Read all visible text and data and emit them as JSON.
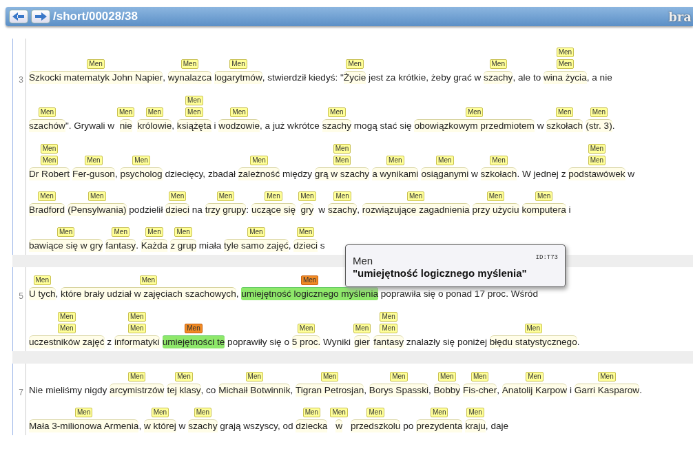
{
  "header": {
    "path": "/short/00028/38",
    "logo": "bra"
  },
  "sentences": [
    {
      "number": "3",
      "lines": [
        {
          "segments": [
            {
              "kind": "span",
              "text": "Szkocki matematyk John Napier",
              "labels": [
                "Men"
              ],
              "highlighted": false
            },
            {
              "kind": "plain",
              "text": ", "
            },
            {
              "kind": "span",
              "text": "wynalazca",
              "labels": [
                "Men"
              ],
              "highlighted": false
            },
            {
              "kind": "span",
              "text": "logarytmów",
              "labels": [
                "Men"
              ],
              "highlighted": false
            },
            {
              "kind": "plain",
              "text": ", stwierdził kiedyś: \""
            },
            {
              "kind": "span",
              "text": "Życie",
              "labels": [
                "Men"
              ],
              "highlighted": false
            },
            {
              "kind": "plain",
              "text": " jest za krótkie, żeby grać w "
            },
            {
              "kind": "span",
              "text": "szachy",
              "labels": [
                "Men"
              ],
              "highlighted": false
            },
            {
              "kind": "plain",
              "text": ", ale to "
            },
            {
              "kind": "span",
              "text": "wina życia",
              "labels": [
                "Men",
                "Men"
              ],
              "highlighted": false
            },
            {
              "kind": "plain",
              "text": ", a nie"
            }
          ]
        },
        {
          "segments": [
            {
              "kind": "span",
              "text": "szachów",
              "labels": [
                "Men"
              ],
              "highlighted": false
            },
            {
              "kind": "plain",
              "text": "\". Grywali w "
            },
            {
              "kind": "span",
              "text": "nie",
              "labels": [
                "Men"
              ],
              "highlighted": false
            },
            {
              "kind": "span",
              "text": "królowie",
              "labels": [
                "Men"
              ],
              "highlighted": false
            },
            {
              "kind": "plain",
              "text": ", "
            },
            {
              "kind": "span",
              "text": "książęta",
              "labels": [
                "Men",
                "Men"
              ],
              "highlighted": false
            },
            {
              "kind": "plain",
              "text": " i "
            },
            {
              "kind": "span",
              "text": "wodzowie",
              "labels": [
                "Men"
              ],
              "highlighted": false
            },
            {
              "kind": "plain",
              "text": ", a już wkrótce "
            },
            {
              "kind": "span",
              "text": "szachy",
              "labels": [
                "Men"
              ],
              "highlighted": false
            },
            {
              "kind": "plain",
              "text": " mogą stać się "
            },
            {
              "kind": "span",
              "text": "obowiązkowym przedmiotem",
              "labels": [
                "Men"
              ],
              "highlighted": false
            },
            {
              "kind": "plain",
              "text": " w "
            },
            {
              "kind": "span",
              "text": "szkołach",
              "labels": [
                "Men"
              ],
              "highlighted": false
            },
            {
              "kind": "span",
              "text": "(str. 3)",
              "labels": [
                "Men"
              ],
              "highlighted": false
            },
            {
              "kind": "plain",
              "text": "."
            }
          ]
        },
        {
          "segments": [
            {
              "kind": "span",
              "text": "Dr Robert",
              "labels": [
                "Men",
                "Men"
              ],
              "highlighted": false
            },
            {
              "kind": "span",
              "text": "Fer-guson",
              "labels": [
                "Men"
              ],
              "highlighted": false
            },
            {
              "kind": "plain",
              "text": ", "
            },
            {
              "kind": "span",
              "text": "psycholog",
              "labels": [
                "Men"
              ],
              "highlighted": false
            },
            {
              "kind": "plain",
              "text": " dziecięcy, zbadał "
            },
            {
              "kind": "span",
              "text": "zależność",
              "labels": [
                "Men"
              ],
              "highlighted": false
            },
            {
              "kind": "plain",
              "text": " między "
            },
            {
              "kind": "span",
              "text": "grą w szachy",
              "labels": [
                "Men",
                "Men"
              ],
              "highlighted": false
            },
            {
              "kind": "span",
              "text": "a wynikami",
              "labels": [
                "Men"
              ],
              "highlighted": false
            },
            {
              "kind": "span",
              "text": "osiąganymi",
              "labels": [
                "Men"
              ],
              "highlighted": false
            },
            {
              "kind": "plain",
              "text": " w "
            },
            {
              "kind": "span",
              "text": "szkołach",
              "labels": [
                "Men"
              ],
              "highlighted": false
            },
            {
              "kind": "plain",
              "text": ". W jednej z "
            },
            {
              "kind": "span",
              "text": "podstawówek",
              "labels": [
                "Men",
                "Men"
              ],
              "highlighted": false
            },
            {
              "kind": "plain",
              "text": " w"
            }
          ]
        },
        {
          "segments": [
            {
              "kind": "span",
              "text": "Bradford",
              "labels": [
                "Men"
              ],
              "highlighted": false
            },
            {
              "kind": "span",
              "text": "(Pensylwania)",
              "labels": [
                "Men"
              ],
              "highlighted": false
            },
            {
              "kind": "plain",
              "text": " podzielił "
            },
            {
              "kind": "span",
              "text": "dzieci",
              "labels": [
                "Men"
              ],
              "highlighted": false
            },
            {
              "kind": "plain",
              "text": " na "
            },
            {
              "kind": "span",
              "text": "trzy grupy",
              "labels": [
                "Men"
              ],
              "highlighted": false
            },
            {
              "kind": "plain",
              "text": ": "
            },
            {
              "kind": "span",
              "text": "uczące się",
              "labels": [
                "Men"
              ],
              "highlighted": false
            },
            {
              "kind": "span",
              "text": "gry",
              "labels": [
                "Men"
              ],
              "highlighted": false
            },
            {
              "kind": "plain",
              "text": " w "
            },
            {
              "kind": "span",
              "text": "szachy",
              "labels": [
                "Men"
              ],
              "highlighted": false
            },
            {
              "kind": "plain",
              "text": ", "
            },
            {
              "kind": "span",
              "text": "rozwiązujące zagadnienia",
              "labels": [
                "Men"
              ],
              "highlighted": false
            },
            {
              "kind": "span",
              "text": "przy użyciu",
              "labels": [
                "Men"
              ],
              "highlighted": false
            },
            {
              "kind": "span",
              "text": "komputera",
              "labels": [
                "Men"
              ],
              "highlighted": false
            },
            {
              "kind": "plain",
              "text": " i"
            }
          ]
        },
        {
          "segments": [
            {
              "kind": "span",
              "text": "bawiące się w gry",
              "labels": [
                "Men"
              ],
              "highlighted": false
            },
            {
              "kind": "span",
              "text": "fantasy",
              "labels": [
                "Men"
              ],
              "highlighted": false
            },
            {
              "kind": "plain",
              "text": ". "
            },
            {
              "kind": "span",
              "text": "Każda",
              "labels": [
                "Men"
              ],
              "highlighted": false
            },
            {
              "kind": "span",
              "text": "z grup",
              "labels": [
                "Men"
              ],
              "highlighted": false
            },
            {
              "kind": "plain",
              "text": " miała "
            },
            {
              "kind": "span",
              "text": "tyle samo zajęć",
              "labels": [
                "Men"
              ],
              "highlighted": false
            },
            {
              "kind": "plain",
              "text": ", "
            },
            {
              "kind": "span",
              "text": "dzieci",
              "labels": [
                "Men"
              ],
              "highlighted": false
            },
            {
              "kind": "plain",
              "text": " s"
            }
          ]
        }
      ]
    },
    {
      "number": "5",
      "lines": [
        {
          "segments": [
            {
              "kind": "span",
              "text": "U tych",
              "labels": [
                "Men"
              ],
              "highlighted": false
            },
            {
              "kind": "plain",
              "text": ", "
            },
            {
              "kind": "span",
              "text": "które brały udział w zajęciach szachowych",
              "labels": [
                "Men"
              ],
              "highlighted": false
            },
            {
              "kind": "plain",
              "text": ", "
            },
            {
              "kind": "span",
              "text": "umiejętność logicznego myślenia",
              "labels": [
                "Men"
              ],
              "highlighted": true
            },
            {
              "kind": "plain",
              "text": " poprawiła się o ponad 17 proc. Wśród"
            }
          ]
        },
        {
          "segments": [
            {
              "kind": "span",
              "text": "uczestników zajęć",
              "labels": [
                "Men",
                "Men"
              ],
              "highlighted": false
            },
            {
              "kind": "plain",
              "text": " z "
            },
            {
              "kind": "span",
              "text": "informatyki",
              "labels": [
                "Men",
                "Men"
              ],
              "highlighted": false
            },
            {
              "kind": "span",
              "text": "umiejętności te",
              "labels": [
                "Men"
              ],
              "highlighted": true
            },
            {
              "kind": "plain",
              "text": " poprawiły się o "
            },
            {
              "kind": "span",
              "text": "5 proc.",
              "labels": [
                "Men"
              ],
              "highlighted": false
            },
            {
              "kind": "plain",
              "text": " Wyniki "
            },
            {
              "kind": "span",
              "text": "gier",
              "labels": [
                "Men"
              ],
              "highlighted": false
            },
            {
              "kind": "span",
              "text": "fantasy",
              "labels": [
                "Men",
                "Men"
              ],
              "highlighted": false
            },
            {
              "kind": "plain",
              "text": " znalazły się poniżej "
            },
            {
              "kind": "span",
              "text": "błędu statystycznego",
              "labels": [
                "Men"
              ],
              "highlighted": false
            },
            {
              "kind": "plain",
              "text": "."
            }
          ]
        }
      ]
    },
    {
      "number": "7",
      "lines": [
        {
          "segments": [
            {
              "kind": "plain",
              "text": "Nie mieliśmy nigdy "
            },
            {
              "kind": "span",
              "text": "arcymistrzów",
              "labels": [
                "Men"
              ],
              "highlighted": false
            },
            {
              "kind": "span",
              "text": "tej klasy",
              "labels": [
                "Men"
              ],
              "highlighted": false
            },
            {
              "kind": "plain",
              "text": ", co "
            },
            {
              "kind": "span",
              "text": "Michaił Botwinnik",
              "labels": [
                "Men"
              ],
              "highlighted": false
            },
            {
              "kind": "plain",
              "text": ", "
            },
            {
              "kind": "span",
              "text": "Tigran Petrosjan",
              "labels": [
                "Men"
              ],
              "highlighted": false
            },
            {
              "kind": "plain",
              "text": ", "
            },
            {
              "kind": "span",
              "text": "Borys Spasski",
              "labels": [
                "Men"
              ],
              "highlighted": false
            },
            {
              "kind": "plain",
              "text": ", "
            },
            {
              "kind": "span",
              "text": "Bobby",
              "labels": [
                "Men"
              ],
              "highlighted": false
            },
            {
              "kind": "span",
              "text": "Fis-cher",
              "labels": [
                "Men"
              ],
              "highlighted": false
            },
            {
              "kind": "plain",
              "text": ", "
            },
            {
              "kind": "span",
              "text": "Anatolij Karpow",
              "labels": [
                "Men"
              ],
              "highlighted": false
            },
            {
              "kind": "plain",
              "text": " i "
            },
            {
              "kind": "span",
              "text": "Garri Kasparow",
              "labels": [
                "Men"
              ],
              "highlighted": false
            },
            {
              "kind": "plain",
              "text": "."
            }
          ]
        },
        {
          "segments": [
            {
              "kind": "span",
              "text": "Mała 3-milionowa Armenia",
              "labels": [
                "Men"
              ],
              "highlighted": false
            },
            {
              "kind": "plain",
              "text": ", "
            },
            {
              "kind": "span",
              "text": "w której",
              "labels": [
                "Men"
              ],
              "highlighted": false
            },
            {
              "kind": "plain",
              "text": " w "
            },
            {
              "kind": "span",
              "text": "szachy",
              "labels": [
                "Men"
              ],
              "highlighted": false
            },
            {
              "kind": "plain",
              "text": " grają wszyscy, od "
            },
            {
              "kind": "span",
              "text": "dziecka",
              "labels": [
                "Men"
              ],
              "highlighted": false
            },
            {
              "kind": "span",
              "text": "w",
              "labels": [
                "Men"
              ],
              "highlighted": false
            },
            {
              "kind": "span",
              "text": "przedszkolu",
              "labels": [
                "Men"
              ],
              "highlighted": false
            },
            {
              "kind": "plain",
              "text": " po "
            },
            {
              "kind": "span",
              "text": "prezydenta",
              "labels": [
                "Men"
              ],
              "highlighted": false
            },
            {
              "kind": "span",
              "text": "kraju",
              "labels": [
                "Men"
              ],
              "highlighted": false
            },
            {
              "kind": "plain",
              "text": ", daje"
            }
          ]
        }
      ]
    }
  ],
  "tooltip": {
    "type": "Men",
    "id": "ID:T73",
    "text": "\"umiejętność logicznego myślenia\""
  }
}
